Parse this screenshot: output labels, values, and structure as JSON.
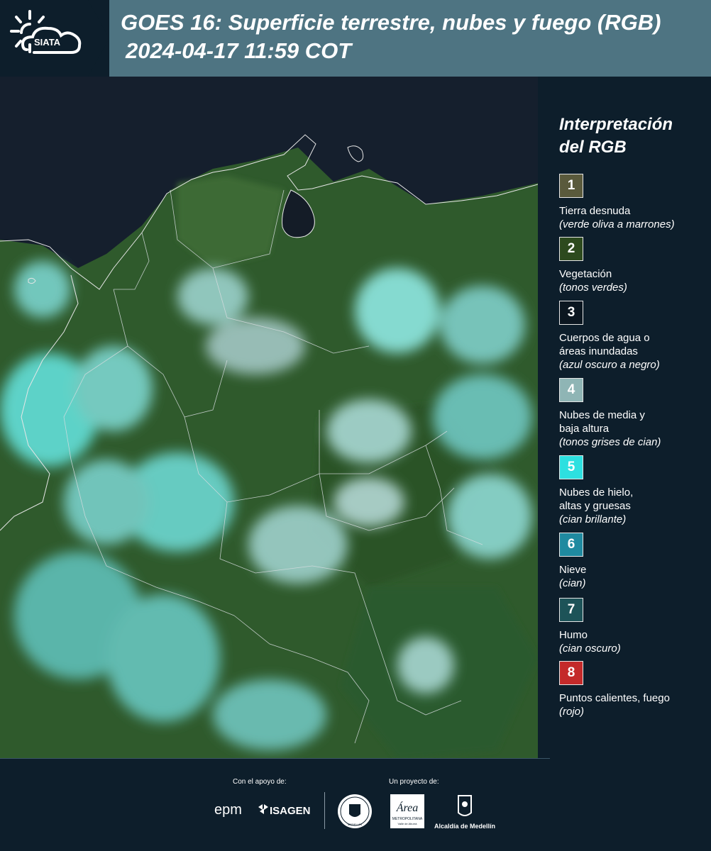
{
  "header": {
    "logo_text": "SIATA",
    "title": "GOES 16: Superficie terrestre, nubes y fuego (RGB)",
    "timestamp": "2024-04-17 11:59 COT"
  },
  "legend": {
    "title_line1": "Interpretación",
    "title_line2": "del RGB",
    "items": [
      {
        "number": "1",
        "label": "Tierra desnuda",
        "sub": "(verde oliva a marrones)",
        "color": "#5a5a3c"
      },
      {
        "number": "2",
        "label": "Vegetación",
        "sub": "(tonos verdes)",
        "color": "#2d4a1e"
      },
      {
        "number": "3",
        "label_line1": "Cuerpos de agua o",
        "label_line2": "áreas inundadas",
        "sub": "(azul oscuro a negro)",
        "color": "#0b1620"
      },
      {
        "number": "4",
        "label_line1": "Nubes de media y",
        "label_line2": "baja altura",
        "sub": "(tonos grises de cian)",
        "color": "#8fb5b5"
      },
      {
        "number": "5",
        "label_line1": "Nubes de hielo,",
        "label_line2": "altas y gruesas",
        "sub": "(cian brillante)",
        "color": "#2de0e0"
      },
      {
        "number": "6",
        "label": "Nieve",
        "sub": "(cian)",
        "color": "#1f8aa0"
      },
      {
        "number": "7",
        "label": "Humo",
        "sub": "(cian oscuro)",
        "color": "#1d5358"
      },
      {
        "number": "8",
        "label": "Puntos calientes, fuego",
        "sub": "(rojo)",
        "color": "#c42a2a"
      }
    ]
  },
  "footer": {
    "support_label": "Con el apoyo de:",
    "project_label": "Un proyecto de:",
    "sponsors": {
      "epm": "epm",
      "isagen": "ISAGEN",
      "area_main": "Área",
      "area_sub1": "METROPOLITANA",
      "area_sub2": "Valle de Aburrá",
      "alcaldia": "Alcaldía de Medellín",
      "seal_text": "MEDELLÍN"
    }
  }
}
